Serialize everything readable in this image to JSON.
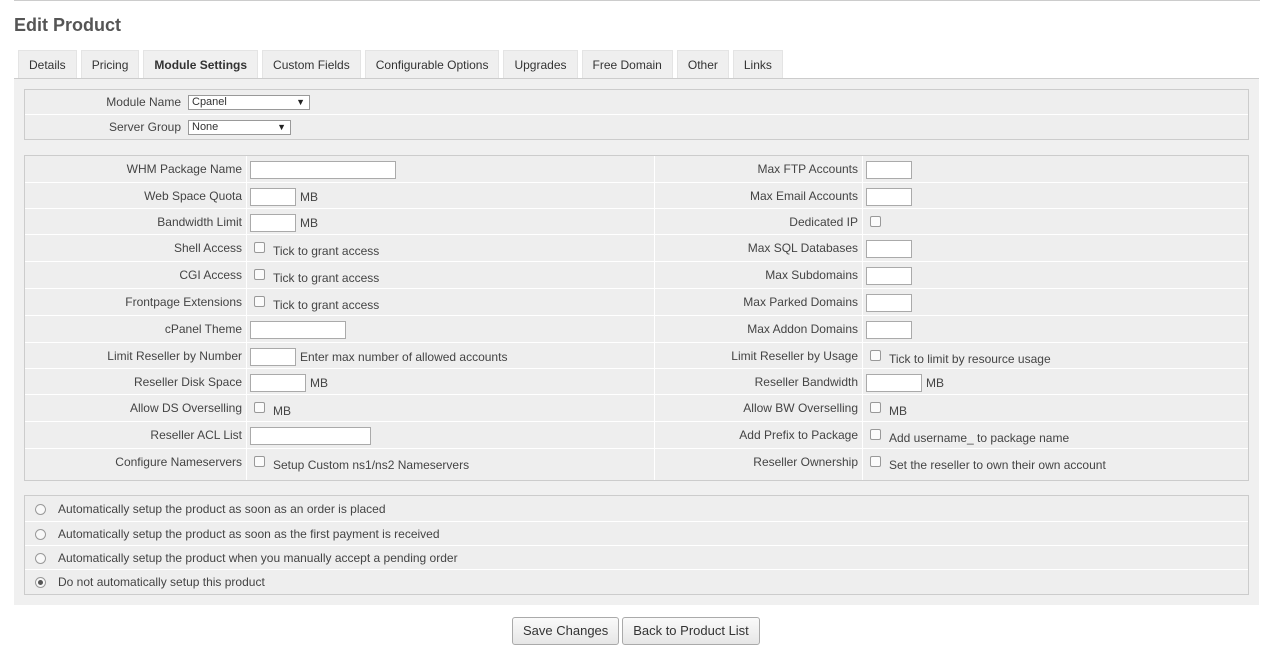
{
  "page": {
    "title": "Edit Product"
  },
  "tabs": [
    {
      "label": "Details",
      "active": false
    },
    {
      "label": "Pricing",
      "active": false
    },
    {
      "label": "Module Settings",
      "active": true
    },
    {
      "label": "Custom Fields",
      "active": false
    },
    {
      "label": "Configurable Options",
      "active": false
    },
    {
      "label": "Upgrades",
      "active": false
    },
    {
      "label": "Free Domain",
      "active": false
    },
    {
      "label": "Other",
      "active": false
    },
    {
      "label": "Links",
      "active": false
    }
  ],
  "module": {
    "name_label": "Module Name",
    "name_value": "Cpanel",
    "server_group_label": "Server Group",
    "server_group_value": "None"
  },
  "settings": {
    "left": [
      {
        "label": "WHM Package Name",
        "type": "text",
        "value": "",
        "suffix": ""
      },
      {
        "label": "Web Space Quota",
        "type": "text",
        "value": "",
        "suffix": "MB"
      },
      {
        "label": "Bandwidth Limit",
        "type": "text",
        "value": "",
        "suffix": "MB"
      },
      {
        "label": "Shell Access",
        "type": "checkbox",
        "checked": false,
        "suffix": "Tick to grant access"
      },
      {
        "label": "CGI Access",
        "type": "checkbox",
        "checked": false,
        "suffix": "Tick to grant access"
      },
      {
        "label": "Frontpage Extensions",
        "type": "checkbox",
        "checked": false,
        "suffix": "Tick to grant access"
      },
      {
        "label": "cPanel Theme",
        "type": "text",
        "value": "",
        "suffix": ""
      },
      {
        "label": "Limit Reseller by Number",
        "type": "text",
        "value": "",
        "suffix": "Enter max number of allowed accounts"
      },
      {
        "label": "Reseller Disk Space",
        "type": "text",
        "value": "",
        "suffix": "MB"
      },
      {
        "label": "Allow DS Overselling",
        "type": "checkbox",
        "checked": false,
        "suffix": "MB"
      },
      {
        "label": "Reseller ACL List",
        "type": "text",
        "value": "",
        "suffix": ""
      },
      {
        "label": "Configure Nameservers",
        "type": "checkbox",
        "checked": false,
        "suffix": "Setup Custom ns1/ns2 Nameservers"
      }
    ],
    "right": [
      {
        "label": "Max FTP Accounts",
        "type": "text",
        "value": "",
        "suffix": ""
      },
      {
        "label": "Max Email Accounts",
        "type": "text",
        "value": "",
        "suffix": ""
      },
      {
        "label": "Dedicated IP",
        "type": "checkbox",
        "checked": false,
        "suffix": ""
      },
      {
        "label": "Max SQL Databases",
        "type": "text",
        "value": "",
        "suffix": ""
      },
      {
        "label": "Max Subdomains",
        "type": "text",
        "value": "",
        "suffix": ""
      },
      {
        "label": "Max Parked Domains",
        "type": "text",
        "value": "",
        "suffix": ""
      },
      {
        "label": "Max Addon Domains",
        "type": "text",
        "value": "",
        "suffix": ""
      },
      {
        "label": "Limit Reseller by Usage",
        "type": "checkbox",
        "checked": false,
        "suffix": "Tick to limit by resource usage"
      },
      {
        "label": "Reseller Bandwidth",
        "type": "text",
        "value": "",
        "suffix": "MB"
      },
      {
        "label": "Allow BW Overselling",
        "type": "checkbox",
        "checked": false,
        "suffix": "MB"
      },
      {
        "label": "Add Prefix to Package",
        "type": "checkbox",
        "checked": false,
        "suffix": "Add username_ to package name"
      },
      {
        "label": "Reseller Ownership",
        "type": "checkbox",
        "checked": false,
        "suffix": "Set the reseller to own their own account"
      }
    ]
  },
  "setup_options": [
    {
      "label": "Automatically setup the product as soon as an order is placed",
      "checked": false
    },
    {
      "label": "Automatically setup the product as soon as the first payment is received",
      "checked": false
    },
    {
      "label": "Automatically setup the product when you manually accept a pending order",
      "checked": false
    },
    {
      "label": "Do not automatically setup this product",
      "checked": true
    }
  ],
  "buttons": {
    "save": "Save Changes",
    "back": "Back to Product List"
  }
}
